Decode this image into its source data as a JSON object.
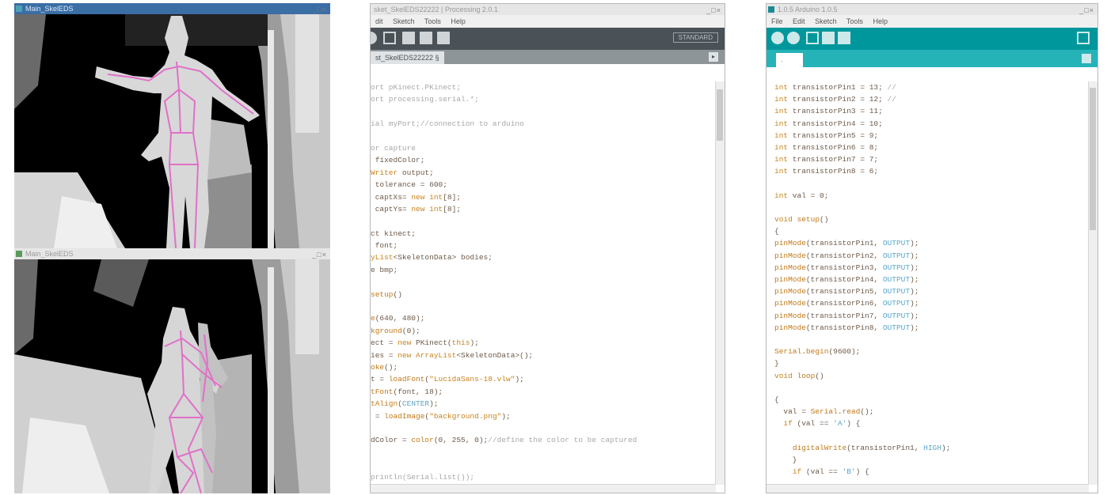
{
  "kinect_window": {
    "title_top": "Main_SkelEDS",
    "title_bottom": "Main_SkelEDS",
    "controls": "_□×",
    "skeleton_color": "#e070c8"
  },
  "processing": {
    "title": "sket_SkelEDS22222 | Processing 2.0.1",
    "controls": "_□×",
    "menu": [
      "dit",
      "Sketch",
      "Tools",
      "Help"
    ],
    "mode_label": "STANDARD",
    "tab_label": "st_SkelEDS22222 §",
    "tab_arrow": "▸",
    "code_lines": [
      {
        "parts": [
          {
            "t": "ort pKinect.PKinect;",
            "c": "cm"
          }
        ]
      },
      {
        "parts": [
          {
            "t": "ort processing.serial.*;",
            "c": "cm"
          }
        ]
      },
      {
        "parts": [
          {
            "t": ""
          }
        ]
      },
      {
        "parts": [
          {
            "t": "ial myPort;//connection to arduino",
            "c": "cm"
          }
        ]
      },
      {
        "parts": [
          {
            "t": ""
          }
        ]
      },
      {
        "parts": [
          {
            "t": "or capture",
            "c": "cm"
          }
        ]
      },
      {
        "parts": [
          {
            "t": " fixedColor;"
          }
        ]
      },
      {
        "parts": [
          {
            "t": "Writer",
            "c": "kw"
          },
          {
            "t": " output;"
          }
        ]
      },
      {
        "parts": [
          {
            "t": " tolerance = 600;"
          }
        ]
      },
      {
        "parts": [
          {
            "t": " captXs= "
          },
          {
            "t": "new int",
            "c": "kw"
          },
          {
            "t": "[8];"
          }
        ]
      },
      {
        "parts": [
          {
            "t": " captYs= "
          },
          {
            "t": "new int",
            "c": "kw"
          },
          {
            "t": "[8];"
          }
        ]
      },
      {
        "parts": [
          {
            "t": ""
          }
        ]
      },
      {
        "parts": [
          {
            "t": "ct kinect;"
          }
        ]
      },
      {
        "parts": [
          {
            "t": " font;"
          }
        ]
      },
      {
        "parts": [
          {
            "t": "yList",
            "c": "kw"
          },
          {
            "t": "<SkeletonData> bodies;"
          }
        ]
      },
      {
        "parts": [
          {
            "t": "e bmp;"
          }
        ]
      },
      {
        "parts": [
          {
            "t": ""
          }
        ]
      },
      {
        "parts": [
          {
            "t": "setup",
            "c": "fn"
          },
          {
            "t": "()"
          }
        ]
      },
      {
        "parts": [
          {
            "t": ""
          }
        ]
      },
      {
        "parts": [
          {
            "t": "e",
            "c": "fn"
          },
          {
            "t": "(640, 480);"
          }
        ]
      },
      {
        "parts": [
          {
            "t": "kground",
            "c": "fn"
          },
          {
            "t": "(0);"
          }
        ]
      },
      {
        "parts": [
          {
            "t": "ect = "
          },
          {
            "t": "new",
            "c": "kw"
          },
          {
            "t": " PKinect("
          },
          {
            "t": "this",
            "c": "kw"
          },
          {
            "t": ");"
          }
        ]
      },
      {
        "parts": [
          {
            "t": "ies = "
          },
          {
            "t": "new",
            "c": "kw"
          },
          {
            "t": " ArrayList",
            "c": "kw"
          },
          {
            "t": "<SkeletonData>();"
          }
        ]
      },
      {
        "parts": [
          {
            "t": "oke",
            "c": "fn"
          },
          {
            "t": "();"
          }
        ]
      },
      {
        "parts": [
          {
            "t": "t = "
          },
          {
            "t": "loadFont",
            "c": "fn"
          },
          {
            "t": "("
          },
          {
            "t": "\"LucidaSans-18.vlw\"",
            "c": "kw"
          },
          {
            "t": ");"
          }
        ]
      },
      {
        "parts": [
          {
            "t": "tFont",
            "c": "fn"
          },
          {
            "t": "(font, 18);"
          }
        ]
      },
      {
        "parts": [
          {
            "t": "tAlign",
            "c": "fn"
          },
          {
            "t": "("
          },
          {
            "t": "CENTER",
            "c": "cn"
          },
          {
            "t": ");"
          }
        ]
      },
      {
        "parts": [
          {
            "t": " = "
          },
          {
            "t": "loadImage",
            "c": "fn"
          },
          {
            "t": "("
          },
          {
            "t": "\"background.png\"",
            "c": "kw"
          },
          {
            "t": ");"
          }
        ]
      },
      {
        "parts": [
          {
            "t": ""
          }
        ]
      },
      {
        "parts": [
          {
            "t": "dColor = "
          },
          {
            "t": "color",
            "c": "fn"
          },
          {
            "t": "(0, 255, 0);"
          },
          {
            "t": "//define the color to be captured",
            "c": "cm"
          }
        ]
      },
      {
        "parts": [
          {
            "t": ""
          }
        ]
      },
      {
        "parts": [
          {
            "t": ""
          }
        ]
      },
      {
        "parts": [
          {
            "t": "println(Serial.list());",
            "c": "cm"
          }
        ]
      }
    ]
  },
  "arduino": {
    "title": "1.0.5 Arduino 1.0.5",
    "controls": "_□×",
    "menu": [
      "File",
      "Edit",
      "Sketch",
      "Tools",
      "Help"
    ],
    "tab_label": ".",
    "code_lines": [
      {
        "parts": [
          {
            "t": "int",
            "c": "kw"
          },
          {
            "t": " transistorPin1 = 13; "
          },
          {
            "t": "//",
            "c": "cm"
          }
        ]
      },
      {
        "parts": [
          {
            "t": "int",
            "c": "kw"
          },
          {
            "t": " transistorPin2 = 12; "
          },
          {
            "t": "//",
            "c": "cm"
          }
        ]
      },
      {
        "parts": [
          {
            "t": "int",
            "c": "kw"
          },
          {
            "t": " transistorPin3 = 11;"
          }
        ]
      },
      {
        "parts": [
          {
            "t": "int",
            "c": "kw"
          },
          {
            "t": " transistorPin4 = 10;"
          }
        ]
      },
      {
        "parts": [
          {
            "t": "int",
            "c": "kw"
          },
          {
            "t": " transistorPin5 = 9;"
          }
        ]
      },
      {
        "parts": [
          {
            "t": "int",
            "c": "kw"
          },
          {
            "t": " transistorPin6 = 8;"
          }
        ]
      },
      {
        "parts": [
          {
            "t": "int",
            "c": "kw"
          },
          {
            "t": " transistorPin7 = 7;"
          }
        ]
      },
      {
        "parts": [
          {
            "t": "int",
            "c": "kw"
          },
          {
            "t": " transistorPin8 = 6;"
          }
        ]
      },
      {
        "parts": [
          {
            "t": ""
          }
        ]
      },
      {
        "parts": [
          {
            "t": "int",
            "c": "kw"
          },
          {
            "t": " val = 0;"
          }
        ]
      },
      {
        "parts": [
          {
            "t": ""
          }
        ]
      },
      {
        "parts": [
          {
            "t": "void",
            "c": "kw"
          },
          {
            "t": " "
          },
          {
            "t": "setup",
            "c": "fn"
          },
          {
            "t": "()"
          }
        ]
      },
      {
        "parts": [
          {
            "t": "{"
          }
        ]
      },
      {
        "parts": [
          {
            "t": "pinMode",
            "c": "fn"
          },
          {
            "t": "(transistorPin1, "
          },
          {
            "t": "OUTPUT",
            "c": "cn"
          },
          {
            "t": ");"
          }
        ]
      },
      {
        "parts": [
          {
            "t": "pinMode",
            "c": "fn"
          },
          {
            "t": "(transistorPin2, "
          },
          {
            "t": "OUTPUT",
            "c": "cn"
          },
          {
            "t": ");"
          }
        ]
      },
      {
        "parts": [
          {
            "t": "pinMode",
            "c": "fn"
          },
          {
            "t": "(transistorPin3, "
          },
          {
            "t": "OUTPUT",
            "c": "cn"
          },
          {
            "t": ");"
          }
        ]
      },
      {
        "parts": [
          {
            "t": "pinMode",
            "c": "fn"
          },
          {
            "t": "(transistorPin4, "
          },
          {
            "t": "OUTPUT",
            "c": "cn"
          },
          {
            "t": ");"
          }
        ]
      },
      {
        "parts": [
          {
            "t": "pinMode",
            "c": "fn"
          },
          {
            "t": "(transistorPin5, "
          },
          {
            "t": "OUTPUT",
            "c": "cn"
          },
          {
            "t": ");"
          }
        ]
      },
      {
        "parts": [
          {
            "t": "pinMode",
            "c": "fn"
          },
          {
            "t": "(transistorPin6, "
          },
          {
            "t": "OUTPUT",
            "c": "cn"
          },
          {
            "t": ");"
          }
        ]
      },
      {
        "parts": [
          {
            "t": "pinMode",
            "c": "fn"
          },
          {
            "t": "(transistorPin7, "
          },
          {
            "t": "OUTPUT",
            "c": "cn"
          },
          {
            "t": ");"
          }
        ]
      },
      {
        "parts": [
          {
            "t": "pinMode",
            "c": "fn"
          },
          {
            "t": "(transistorPin8, "
          },
          {
            "t": "OUTPUT",
            "c": "cn"
          },
          {
            "t": ");"
          }
        ]
      },
      {
        "parts": [
          {
            "t": ""
          }
        ]
      },
      {
        "parts": [
          {
            "t": "Serial",
            "c": "fn"
          },
          {
            "t": "."
          },
          {
            "t": "begin",
            "c": "fn"
          },
          {
            "t": "(9600);"
          }
        ]
      },
      {
        "parts": [
          {
            "t": "}"
          }
        ]
      },
      {
        "parts": [
          {
            "t": "void",
            "c": "kw"
          },
          {
            "t": " "
          },
          {
            "t": "loop",
            "c": "fn"
          },
          {
            "t": "()"
          }
        ]
      },
      {
        "parts": [
          {
            "t": ""
          }
        ]
      },
      {
        "parts": [
          {
            "t": "{"
          }
        ]
      },
      {
        "parts": [
          {
            "t": "  val = "
          },
          {
            "t": "Serial",
            "c": "fn"
          },
          {
            "t": "."
          },
          {
            "t": "read",
            "c": "fn"
          },
          {
            "t": "();"
          }
        ]
      },
      {
        "parts": [
          {
            "t": "  "
          },
          {
            "t": "if",
            "c": "kw"
          },
          {
            "t": " (val == "
          },
          {
            "t": "'A'",
            "c": "cn"
          },
          {
            "t": ") {"
          }
        ]
      },
      {
        "parts": [
          {
            "t": ""
          }
        ]
      },
      {
        "parts": [
          {
            "t": "    "
          },
          {
            "t": "digitalWrite",
            "c": "fn"
          },
          {
            "t": "(transistorPin1, "
          },
          {
            "t": "HIGH",
            "c": "cn"
          },
          {
            "t": ");"
          }
        ]
      },
      {
        "parts": [
          {
            "t": "    }"
          }
        ]
      },
      {
        "parts": [
          {
            "t": "    "
          },
          {
            "t": "if",
            "c": "kw"
          },
          {
            "t": " (val == "
          },
          {
            "t": "'B'",
            "c": "cn"
          },
          {
            "t": ") {"
          }
        ]
      }
    ]
  }
}
